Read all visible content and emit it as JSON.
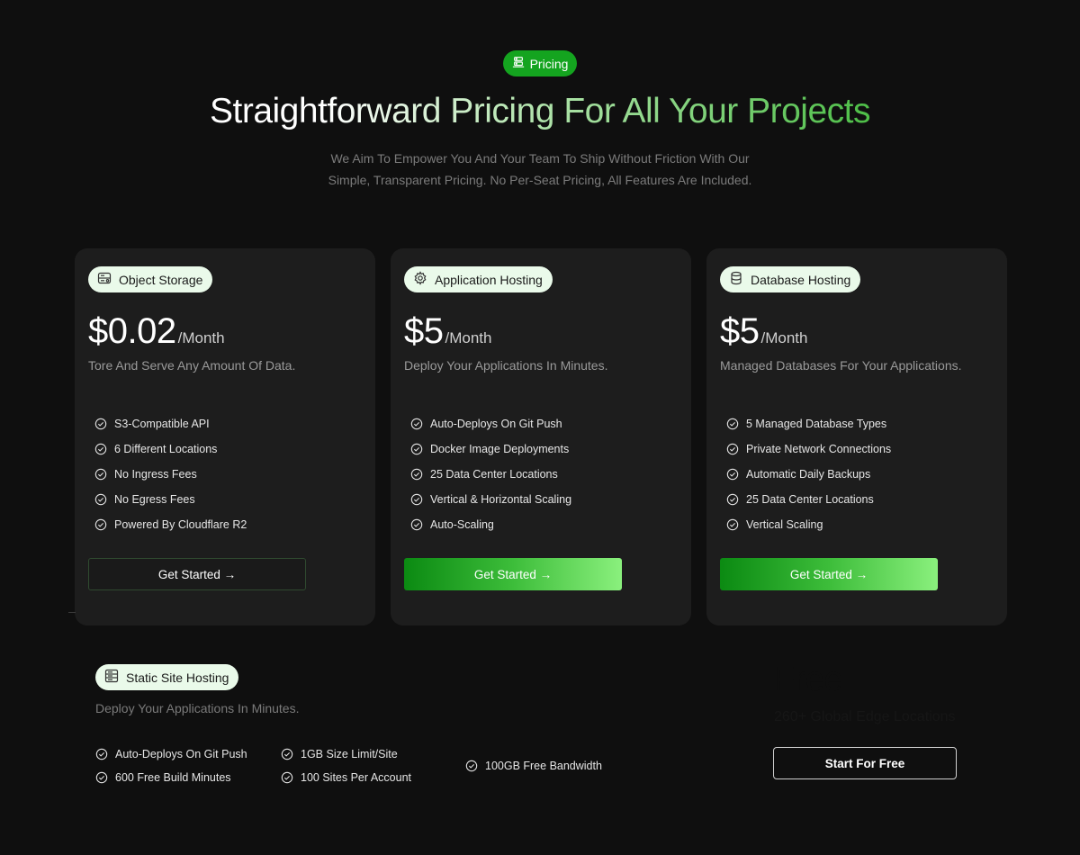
{
  "header": {
    "badge_label": "Pricing",
    "badge_icon": "server-stack-icon",
    "title": "Straightforward Pricing For All Your Projects",
    "subtitle": "We Aim To Empower You And Your Team To Ship Without Friction With Our Simple, Transparent Pricing.  No Per-Seat Pricing, All Features Are Included."
  },
  "plans": [
    {
      "name": "Object Storage",
      "icon": "storage-icon",
      "price": "$0.02",
      "period": "/Month",
      "description": "Tore And Serve Any Amount Of Data.",
      "features": [
        "S3-Compatible API",
        "6 Different Locations",
        "No Ingress Fees",
        "No Egress Fees",
        "Powered By Cloudflare R2"
      ],
      "cta": "Get Started →",
      "cta_style": "outline"
    },
    {
      "name": "Application Hosting",
      "icon": "gear-icon",
      "price": "$5",
      "period": "/Month",
      "description": "Deploy Your Applications In Minutes.",
      "features": [
        "Auto-Deploys On Git Push",
        "Docker Image Deployments",
        "25 Data Center Locations",
        "Vertical & Horizontal Scaling",
        "Auto-Scaling"
      ],
      "cta": "Get Started →",
      "cta_style": "filled"
    },
    {
      "name": "Database Hosting",
      "icon": "database-icon",
      "price": "$5",
      "period": "/Month",
      "description": "Managed Databases For Your Applications.",
      "features": [
        "5 Managed Database Types",
        "Private Network Connections",
        "Automatic Daily Backups",
        "25 Data Center Locations",
        "Vertical Scaling"
      ],
      "cta": "Get Started →",
      "cta_style": "filled"
    }
  ],
  "static_site": {
    "name": "Static Site Hosting",
    "icon": "server-icon",
    "description": "Deploy Your Applications In Minutes.",
    "features": [
      "Auto-Deploys On Git Push",
      "600 Free Build Minutes",
      "1GB Size Limit/Site",
      "100 Sites Per Account",
      "100GB Free Bandwidth"
    ],
    "price": "Free",
    "subtitle": "260+ Global Edge Locations",
    "cta": "Start For Free"
  },
  "colors": {
    "background": "#0f0f0f",
    "card": "#1d1d1d",
    "accent": "#14a41f",
    "pill_bg": "#eafaea"
  }
}
